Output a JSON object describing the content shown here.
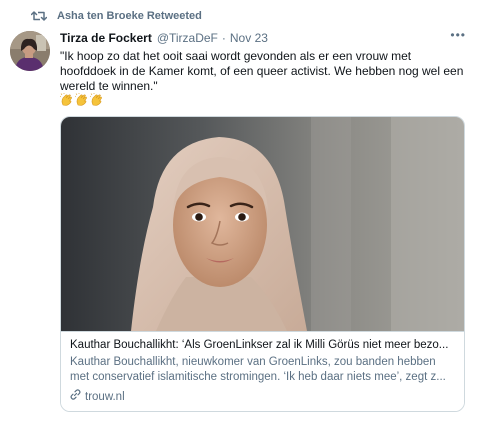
{
  "retweet": {
    "icon": "retweet-icon",
    "text": "Asha ten Broeke Retweeted"
  },
  "author": {
    "display_name": "Tirza de Fockert",
    "handle": "@TirzaDeF",
    "separator": "·",
    "time": "Nov 23",
    "more": "•••"
  },
  "tweet": {
    "text": "\"Ik hoop zo dat het ooit saai wordt gevonden als er een vrouw met hoofddoek in de Kamer komt, of een queer activist. We hebben nog wel een wereld te winnen.\"",
    "emojis": [
      "👏",
      "👏",
      "👏"
    ]
  },
  "card": {
    "title": "Kauthar Bouchallikht: ‘Als GroenLinkser zal ik Milli Görüs niet meer bezo...",
    "description": "Kauthar Bouchallikht, nieuwkomer van GroenLinks, zou banden hebben met conservatief islamitische stromingen. ‘Ik heb daar niets mee’, zegt z...",
    "domain": "trouw.nl",
    "domain_icon": "link-icon"
  },
  "colors": {
    "text": "#0f1419",
    "secondary": "#5b7083",
    "border": "#cfd9de"
  }
}
